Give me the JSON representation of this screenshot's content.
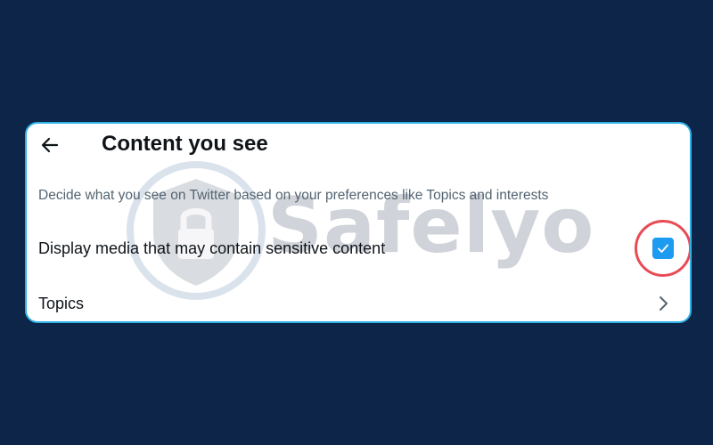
{
  "header": {
    "title": "Content you see",
    "back_icon": "arrow-left-icon"
  },
  "description": "Decide what you see on Twitter based on your preferences like Topics and interests",
  "settings": {
    "sensitive_media": {
      "label": "Display media that may contain sensitive content",
      "checked": true
    },
    "topics": {
      "label": "Topics",
      "icon": "chevron-right-icon"
    }
  },
  "watermark": {
    "text": "Safelyo"
  },
  "colors": {
    "background": "#0c2549",
    "card_border": "#2fb2e6",
    "accent": "#1d9bf0",
    "highlight_ring": "#e94b55"
  }
}
